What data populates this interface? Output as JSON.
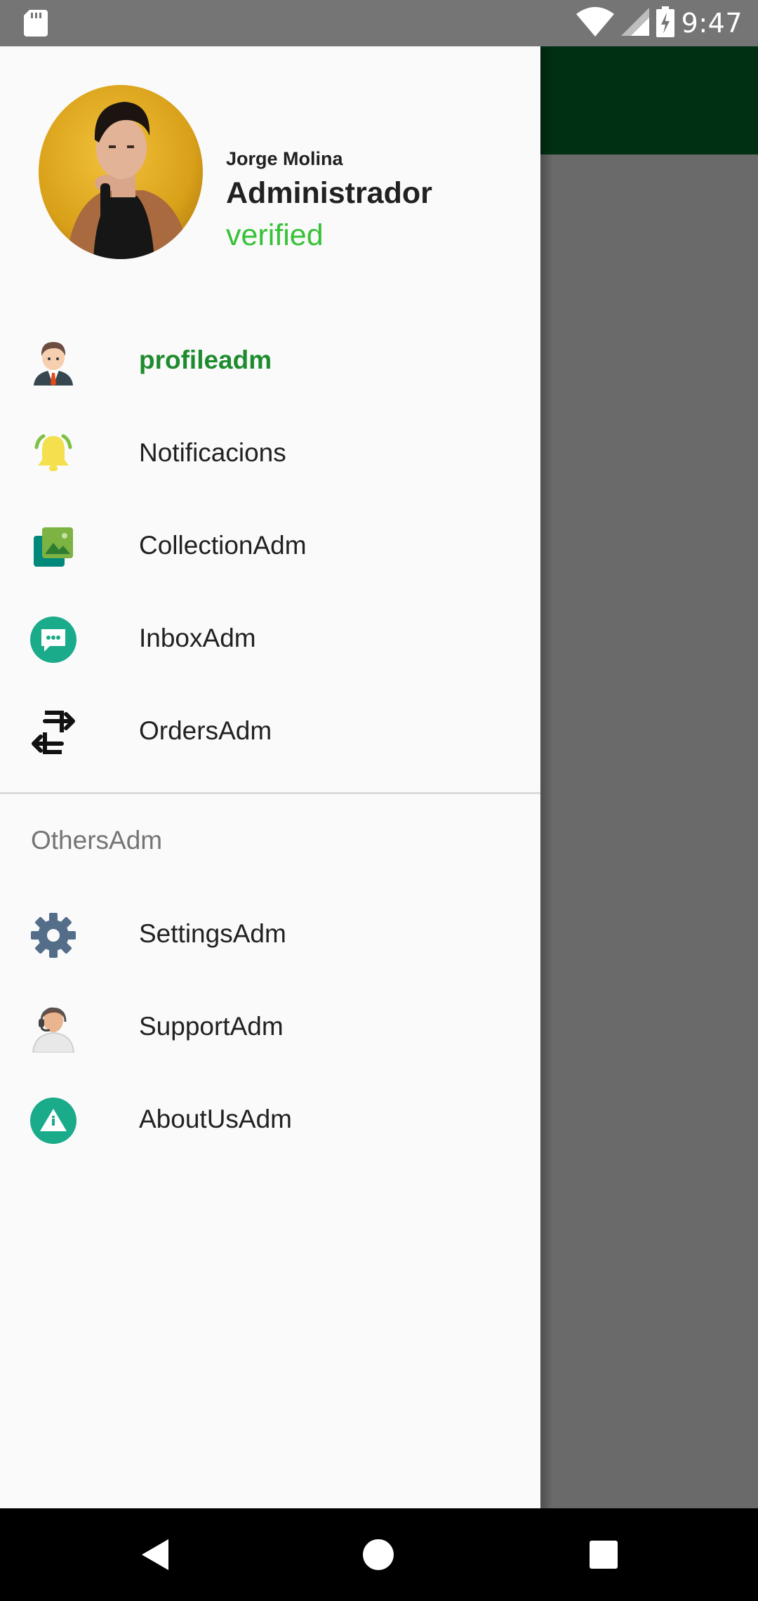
{
  "status_bar": {
    "time": "9:47",
    "icons": [
      "sd-card-icon",
      "wifi-icon",
      "signal-icon",
      "battery-charging-icon"
    ]
  },
  "colors": {
    "toolbar": "#003013",
    "active": "#1e8c2e",
    "verified": "#36c236"
  },
  "header": {
    "name": "Jorge Molina",
    "role": "Administrador",
    "status": "verified"
  },
  "menu": [
    {
      "label": "profileadm",
      "icon": "businessman-icon",
      "active": true
    },
    {
      "label": "Notificacions",
      "icon": "bell-icon",
      "active": false
    },
    {
      "label": "CollectionAdm",
      "icon": "gallery-icon",
      "active": false
    },
    {
      "label": "InboxAdm",
      "icon": "chat-icon",
      "active": false
    },
    {
      "label": "OrdersAdm",
      "icon": "exchange-icon",
      "active": false
    }
  ],
  "others": {
    "title": "OthersAdm",
    "items": [
      {
        "label": "SettingsAdm",
        "icon": "gear-icon"
      },
      {
        "label": "SupportAdm",
        "icon": "support-agent-icon"
      },
      {
        "label": "AboutUsAdm",
        "icon": "info-icon"
      }
    ]
  },
  "nav_bar": {
    "buttons": [
      "back-icon",
      "home-icon",
      "recents-icon"
    ]
  }
}
